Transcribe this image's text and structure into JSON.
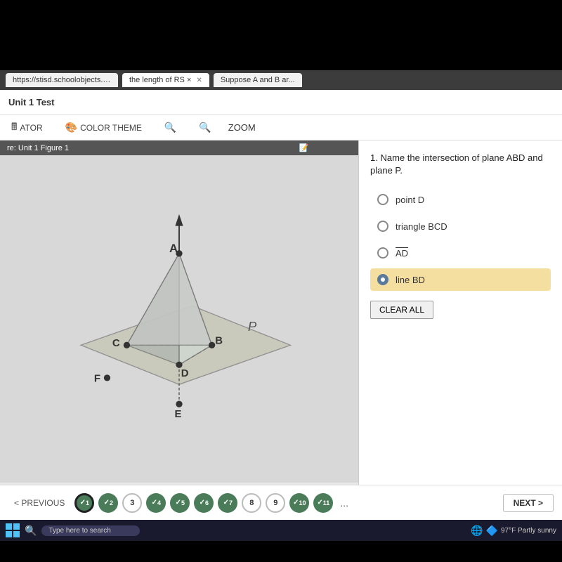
{
  "browser": {
    "tabs": [
      {
        "label": "https://stisd.schoolobjects.com...",
        "active": false
      },
      {
        "label": "the length of RS ×",
        "active": true
      },
      {
        "label": "Suppose A and B ar...",
        "active": false
      }
    ],
    "url": "https://stisd.schoolobjects.com/aware2/onlinetestingapi/onlinetesting?testEntryId=530864&returnView=available"
  },
  "app": {
    "title": "Unit 1 Test"
  },
  "toolbar": {
    "calculator_label": "ATOR",
    "color_theme_label": "COLOR THEME",
    "zoom_label": "ZOOM"
  },
  "figure": {
    "reference_label": "re: Unit 1 Figure 1",
    "add_note_label": "ADD NOTE",
    "points": [
      "A",
      "B",
      "C",
      "D",
      "E",
      "F",
      "P"
    ]
  },
  "question": {
    "number": "1.",
    "text": "Name the intersection of plane ABD and plane P.",
    "options": [
      {
        "id": "a",
        "label": "point D",
        "selected": false,
        "overline": false
      },
      {
        "id": "b",
        "label": "triangle BCD",
        "selected": false,
        "overline": false
      },
      {
        "id": "c",
        "label": "AD",
        "selected": false,
        "overline": true
      },
      {
        "id": "d",
        "label": "line BD",
        "selected": true,
        "overline": false
      }
    ],
    "clear_all_label": "CLEAR ALL"
  },
  "navigation": {
    "previous_label": "< PREVIOUS",
    "next_label": "NEXT >",
    "questions": [
      {
        "num": "1",
        "status": "current"
      },
      {
        "num": "2",
        "status": "answered"
      },
      {
        "num": "3",
        "status": "unanswered"
      },
      {
        "num": "4",
        "status": "answered"
      },
      {
        "num": "5",
        "status": "answered"
      },
      {
        "num": "6",
        "status": "answered"
      },
      {
        "num": "7",
        "status": "answered"
      },
      {
        "num": "8",
        "status": "unanswered"
      },
      {
        "num": "9",
        "status": "unanswered"
      },
      {
        "num": "10",
        "status": "answered"
      },
      {
        "num": "11",
        "status": "answered"
      }
    ],
    "more_label": "..."
  },
  "taskbar": {
    "search_placeholder": "Type here to search",
    "weather": "97°F  Partly sunny",
    "time": ""
  },
  "colors": {
    "selected_bg": "#f5dfa0",
    "answered_green": "#4a7c59",
    "toolbar_bg": "#ffffff",
    "figure_bg": "#d8d8d8"
  }
}
